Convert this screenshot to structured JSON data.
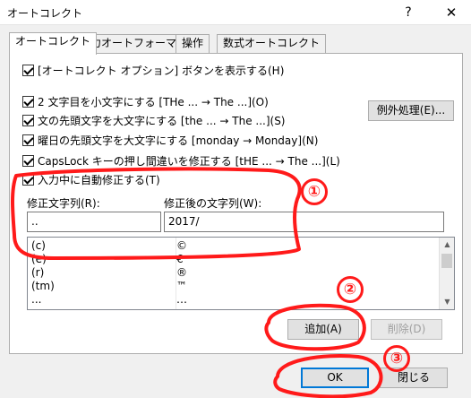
{
  "window": {
    "title": "オートコレクト",
    "help_glyph": "?",
    "close_glyph": "✕"
  },
  "tabs": [
    {
      "label": "オートコレクト",
      "active": true
    },
    {
      "label": "入力オートフォーマット",
      "active": false
    },
    {
      "label": "操作",
      "active": false
    },
    {
      "label": "数式オートコレクト",
      "active": false
    }
  ],
  "options": {
    "show_buttons": {
      "label": "[オートコレクト オプション] ボタンを表示する(H)",
      "checked": true
    },
    "two_initial_caps": {
      "label": "2 文字目を小文字にする [THe ... → The ...](O)",
      "checked": true
    },
    "capitalize_sentence": {
      "label": "文の先頭文字を大文字にする [the ... → The ...](S)",
      "checked": true
    },
    "capitalize_days": {
      "label": "曜日の先頭文字を大文字にする [monday → Monday](N)",
      "checked": true
    },
    "capslock_fix": {
      "label": "CapsLock キーの押し間違いを修正する [tHE ... → The ...](L)",
      "checked": true
    },
    "replace_while_typing": {
      "label": "入力中に自動修正する(T)",
      "checked": true
    }
  },
  "buttons": {
    "exceptions": "例外処理(E)...",
    "add": "追加(A)",
    "delete": "削除(D)",
    "ok": "OK",
    "close": "閉じる"
  },
  "replace": {
    "label": "修正文字列(R):",
    "value": ".."
  },
  "with": {
    "label": "修正後の文字列(W):",
    "value": "2017/"
  },
  "entries": [
    {
      "from": "(c)",
      "to": "©"
    },
    {
      "from": "(e)",
      "to": "€"
    },
    {
      "from": "(r)",
      "to": "®"
    },
    {
      "from": "(tm)",
      "to": "™"
    },
    {
      "from": "...",
      "to": "…"
    }
  ],
  "annotations": {
    "color": "#ff1a1a",
    "step1": "①",
    "step2": "②",
    "step3": "③"
  }
}
